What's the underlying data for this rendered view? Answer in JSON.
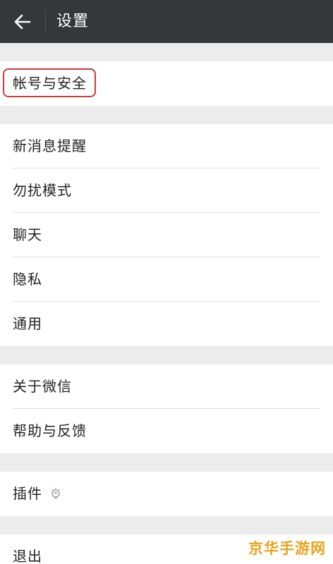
{
  "header": {
    "title": "设置",
    "back_icon": "arrow-left-icon"
  },
  "groups": [
    {
      "items": [
        {
          "label": "帐号与安全",
          "highlighted": true
        }
      ]
    },
    {
      "items": [
        {
          "label": "新消息提醒"
        },
        {
          "label": "勿扰模式"
        },
        {
          "label": "聊天"
        },
        {
          "label": "隐私"
        },
        {
          "label": "通用"
        }
      ]
    },
    {
      "items": [
        {
          "label": "关于微信"
        },
        {
          "label": "帮助与反馈"
        }
      ]
    },
    {
      "items": [
        {
          "label": "插件",
          "icon": "plugin-bulb-icon"
        }
      ]
    },
    {
      "items": [
        {
          "label": "退出"
        }
      ]
    }
  ],
  "colors": {
    "header_bg": "#363739",
    "page_bg": "#ececec",
    "highlight": "#c93b36",
    "watermark": "#e8a31c"
  },
  "watermark": {
    "text": "京华手游网"
  }
}
